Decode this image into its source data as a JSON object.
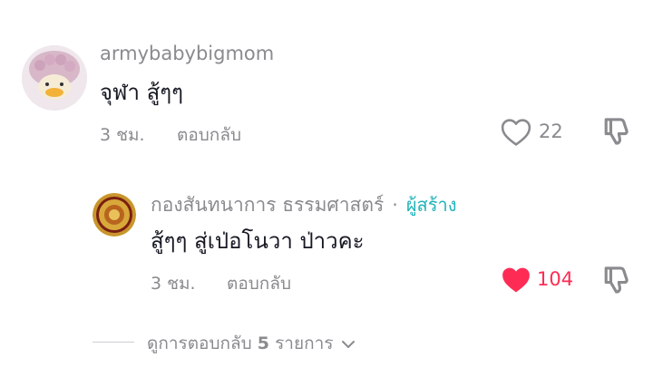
{
  "comment": {
    "username": "armybabybigmom",
    "text": "จุฬา สู้ๆๆ",
    "time": "3 ชม.",
    "reply_label": "ตอบกลับ",
    "like_count": "22",
    "liked": false
  },
  "reply": {
    "username": "กองสันทนาการ ธรรมศาสตร์",
    "separator": "·",
    "creator_label": "ผู้สร้าง",
    "text": "สู้ๆๆ สู่เป่อโนวา ป่าวคะ",
    "time": "3 ชม.",
    "reply_label": "ตอบกลับ",
    "like_count": "104",
    "liked": true
  },
  "view_more": {
    "prefix": "ดูการตอบกลับ",
    "count": "5",
    "suffix": "รายการ"
  },
  "colors": {
    "like_active": "#fe2c55",
    "creator_accent": "#20b3b9",
    "meta_gray": "#8a8a8f"
  },
  "icons": [
    "heart-outline-icon",
    "heart-filled-icon",
    "dislike-icon",
    "chevron-down-icon"
  ]
}
